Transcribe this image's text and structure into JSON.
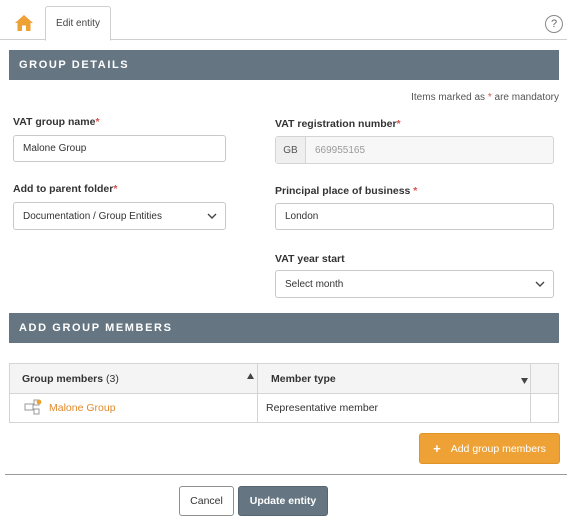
{
  "tabs": {
    "edit_entity": "Edit entity"
  },
  "help": {
    "symbol": "?"
  },
  "sections": {
    "group_details": "GROUP DETAILS",
    "add_group_members": "ADD GROUP MEMBERS"
  },
  "mandatory_note": {
    "prefix": "Items marked as ",
    "star": "*",
    "suffix": " are mandatory"
  },
  "form": {
    "vat_group_name": {
      "label": "VAT group name",
      "value": "Malone Group"
    },
    "vat_registration_number": {
      "label": "VAT registration number",
      "prefix": "GB",
      "value": "669955165"
    },
    "parent_folder": {
      "label": "Add to parent folder",
      "value": "Documentation / Group Entities"
    },
    "principal_place": {
      "label": "Principal place of business ",
      "value": "London"
    },
    "vat_year_start": {
      "label": "VAT year start",
      "value": "Select month"
    },
    "required_marker": "*"
  },
  "members_table": {
    "col_members": "Group members",
    "col_members_count": "(3)",
    "col_type": "Member type",
    "rows": [
      {
        "name": "Malone Group",
        "type": "Representative member"
      }
    ]
  },
  "buttons": {
    "add_members_icon": "+",
    "add_members": "Add group members",
    "cancel": "Cancel",
    "update": "Update entity"
  },
  "colors": {
    "accent": "#eea236",
    "header": "#657682",
    "required": "#d9534f",
    "link": "#e08a2c"
  },
  "icons": [
    "home-icon",
    "help-icon",
    "chevron-down-icon",
    "sort-asc-icon",
    "sort-desc-icon",
    "group-member-icon"
  ]
}
